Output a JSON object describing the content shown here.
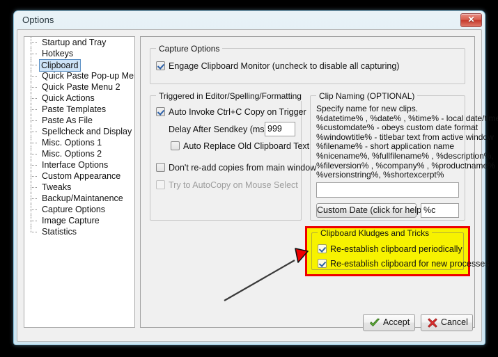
{
  "window": {
    "title": "Options",
    "close_label": "✕"
  },
  "sidebar": {
    "items": [
      {
        "label": "Startup and Tray"
      },
      {
        "label": "Hotkeys"
      },
      {
        "label": "Clipboard"
      },
      {
        "label": "Quick Paste Pop-up Menu"
      },
      {
        "label": "Quick Paste Menu 2"
      },
      {
        "label": "Quick Actions"
      },
      {
        "label": "Paste Templates"
      },
      {
        "label": "Paste As File"
      },
      {
        "label": "Spellcheck and Display"
      },
      {
        "label": "Misc. Options 1"
      },
      {
        "label": "Misc. Options 2"
      },
      {
        "label": "Interface Options"
      },
      {
        "label": "Custom Appearance"
      },
      {
        "label": "Tweaks"
      },
      {
        "label": "Backup/Maintanence"
      },
      {
        "label": "Capture Options"
      },
      {
        "label": "Image Capture"
      },
      {
        "label": "Statistics"
      }
    ],
    "selected_index": 2
  },
  "capture_options": {
    "legend": "Capture Options",
    "engage_monitor_label": "Engage Clipboard Monitor (uncheck to disable all capturing)",
    "engage_monitor_checked": "checked"
  },
  "triggered": {
    "legend": "Triggered in Editor/Spelling/Formatting",
    "auto_invoke_label": "Auto Invoke Ctrl+C Copy on Trigger",
    "delay_label": "Delay After Sendkey (ms):",
    "delay_value": "999",
    "auto_replace_label": "Auto Replace Old Clipboard Text",
    "dont_readd_label": "Don't re-add copies from main window",
    "autocopy_label": "Try to AutoCopy on Mouse Select"
  },
  "clip_naming": {
    "legend": "Clip Naming (OPTIONAL)",
    "help_text": "Specify name for new clips.\n%datetime% , %date% , %time% - local date/time\n%customdate% - obeys custom date format\n%windowtitle% - titlebar text from active window\n%filename% - short application name\n%nicename%, %fullfilename% , %description%,\n%fileversion% , %company% , %productname% ,\n%versionstring%, %shortexcerpt%",
    "name_value": "",
    "name_placeholder": "",
    "custom_date_button": "Custom Date (click for help):",
    "custom_date_value": "%c"
  },
  "kludges": {
    "legend": "Clipboard Kludges and Tricks",
    "periodically_label": "Re-establish clipboard periodically",
    "new_processes_label": "Re-establish clipboard for new processes",
    "highlight_border_color": "#ee0000",
    "highlight_fill_color": "#f7f200"
  },
  "annotation": {
    "arrow_color": "#ee0000",
    "line_color": "#3a3a3a"
  },
  "footer": {
    "accept_label": "Accept",
    "cancel_label": "Cancel",
    "accept_icon_color": "#62b53a",
    "cancel_icon_color": "#e03030"
  }
}
